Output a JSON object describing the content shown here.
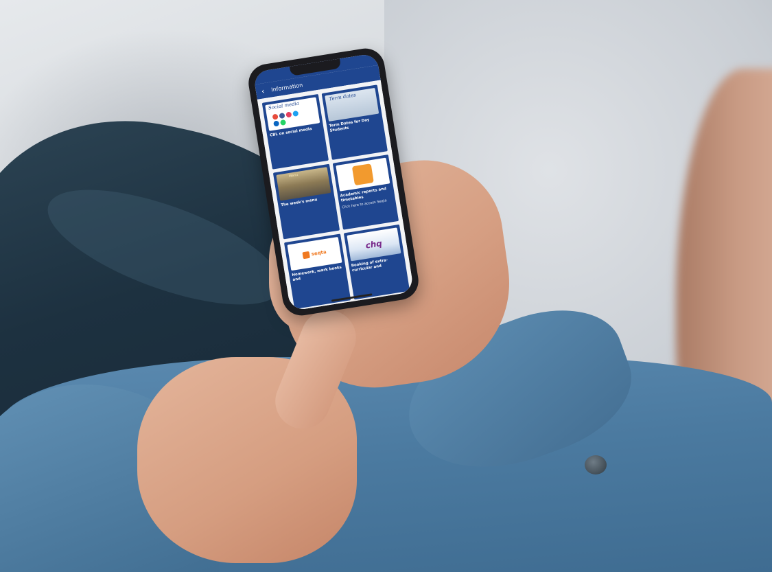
{
  "phone": {
    "status": {
      "time": "",
      "signal": ""
    },
    "header": {
      "back_icon": "chevron-left-icon",
      "title": "Information"
    },
    "cards": [
      {
        "thumb_heading": "Social media",
        "title": "CBL on social media",
        "description": "",
        "colors": [
          "#e74c3c",
          "#3b5998",
          "#e4405f",
          "#1da1f2",
          "#0a66c2",
          "#25d366"
        ]
      },
      {
        "thumb_heading": "Term dates",
        "title": "Term Dates for Day Students",
        "description": "",
        "colors": []
      },
      {
        "thumb_heading": "Menu",
        "title": "The week's menu",
        "description": "",
        "colors": []
      },
      {
        "thumb_heading": "",
        "title": "Academic reports and timetables",
        "description": "Click here to access Seqta",
        "colors": [
          "#f29a2e"
        ]
      },
      {
        "thumb_heading": "seqta",
        "title": "Homework, mark books and",
        "description": "",
        "colors": [
          "#f07a22"
        ]
      },
      {
        "thumb_heading": "chq",
        "title": "Booking of extra-curricular and",
        "description": "",
        "colors": [
          "#7a2c8c"
        ]
      }
    ]
  }
}
